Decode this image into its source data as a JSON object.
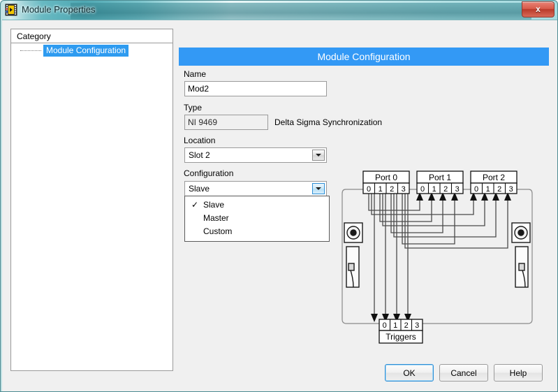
{
  "window": {
    "title": "Module Properties",
    "icon": "labview-icon",
    "close_label": "x",
    "frame_color": "#4fa8b3"
  },
  "category_panel": {
    "header": "Category",
    "items": [
      {
        "label": "Module Configuration",
        "selected": true
      }
    ],
    "selected_color": "#2e9bf0"
  },
  "config_panel": {
    "header": "Module Configuration",
    "header_color": "#3399f5",
    "fields": {
      "name": {
        "label": "Name",
        "value": "Mod2"
      },
      "type": {
        "label": "Type",
        "value": "NI 9469",
        "description": "Delta Sigma Synchronization"
      },
      "location": {
        "label": "Location",
        "value": "Slot 2"
      },
      "configuration": {
        "label": "Configuration",
        "value": "Slave"
      }
    },
    "dropdown": {
      "open": true,
      "items": [
        {
          "label": "Slave",
          "checked": true
        },
        {
          "label": "Master",
          "checked": false
        },
        {
          "label": "Custom",
          "checked": false
        }
      ],
      "check_glyph": "✓"
    }
  },
  "diagram": {
    "ports": [
      {
        "label": "Port 0",
        "channels": [
          "0",
          "1",
          "2",
          "3"
        ],
        "direction": "out"
      },
      {
        "label": "Port 1",
        "channels": [
          "0",
          "1",
          "2",
          "3"
        ],
        "direction": "in"
      },
      {
        "label": "Port 2",
        "channels": [
          "0",
          "1",
          "2",
          "3"
        ],
        "direction": "in"
      }
    ],
    "triggers": {
      "label": "Triggers",
      "channels": [
        "0",
        "1",
        "2",
        "3"
      ],
      "direction": "in"
    }
  },
  "buttons": {
    "ok": "OK",
    "cancel": "Cancel",
    "help": "Help"
  }
}
